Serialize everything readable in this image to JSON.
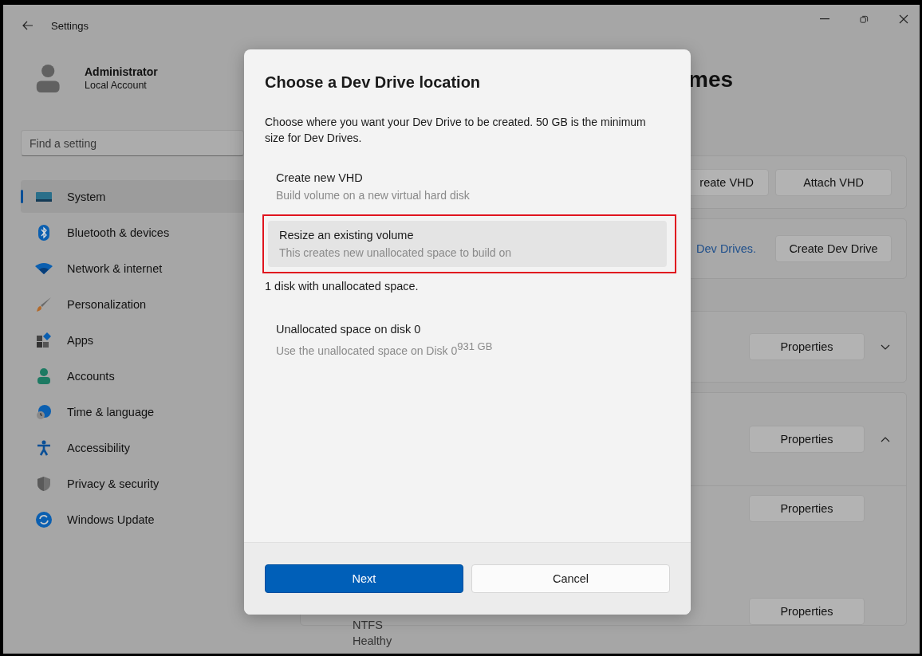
{
  "window": {
    "title": "Settings"
  },
  "account": {
    "name": "Administrator",
    "type": "Local Account"
  },
  "search": {
    "placeholder": "Find a setting"
  },
  "nav": [
    {
      "label": "System",
      "selected": true
    },
    {
      "label": "Bluetooth & devices",
      "selected": false
    },
    {
      "label": "Network & internet",
      "selected": false
    },
    {
      "label": "Personalization",
      "selected": false
    },
    {
      "label": "Apps",
      "selected": false
    },
    {
      "label": "Accounts",
      "selected": false
    },
    {
      "label": "Time & language",
      "selected": false
    },
    {
      "label": "Accessibility",
      "selected": false
    },
    {
      "label": "Privacy & security",
      "selected": false
    },
    {
      "label": "Windows Update",
      "selected": false
    }
  ],
  "page": {
    "title": "mes",
    "cards": [
      {
        "kind": "buttons",
        "buttons": [
          "reate VHD",
          "Attach VHD"
        ]
      },
      {
        "kind": "link",
        "link": "Dev Drives.",
        "button": "Create Dev Drive"
      },
      {
        "kind": "volume",
        "button": "Properties",
        "expanded": false
      },
      {
        "kind": "volume",
        "button": "Properties",
        "expanded": true,
        "rows": [
          {
            "button": "Properties"
          },
          {
            "button": "Properties",
            "details": [
              "NTFS",
              "Healthy"
            ]
          }
        ]
      }
    ]
  },
  "dialog": {
    "title": "Choose a Dev Drive location",
    "description": "Choose where you want your Dev Drive to be created. 50 GB is the minimum size for Dev Drives.",
    "options": [
      {
        "title": "Create new VHD",
        "subtitle": "Build volume on a new virtual hard disk",
        "selected": false,
        "highlighted": false
      },
      {
        "title": "Resize an existing volume",
        "subtitle": "This creates new unallocated space to build on",
        "selected": true,
        "highlighted": true
      }
    ],
    "disk_count": "1 disk with unallocated space.",
    "disks": [
      {
        "title": "Unallocated space on disk 0",
        "subtitle": "Use the unallocated space on Disk 0",
        "size": "931 GB",
        "selected": false
      }
    ],
    "primary_button": "Next",
    "secondary_button": "Cancel"
  }
}
